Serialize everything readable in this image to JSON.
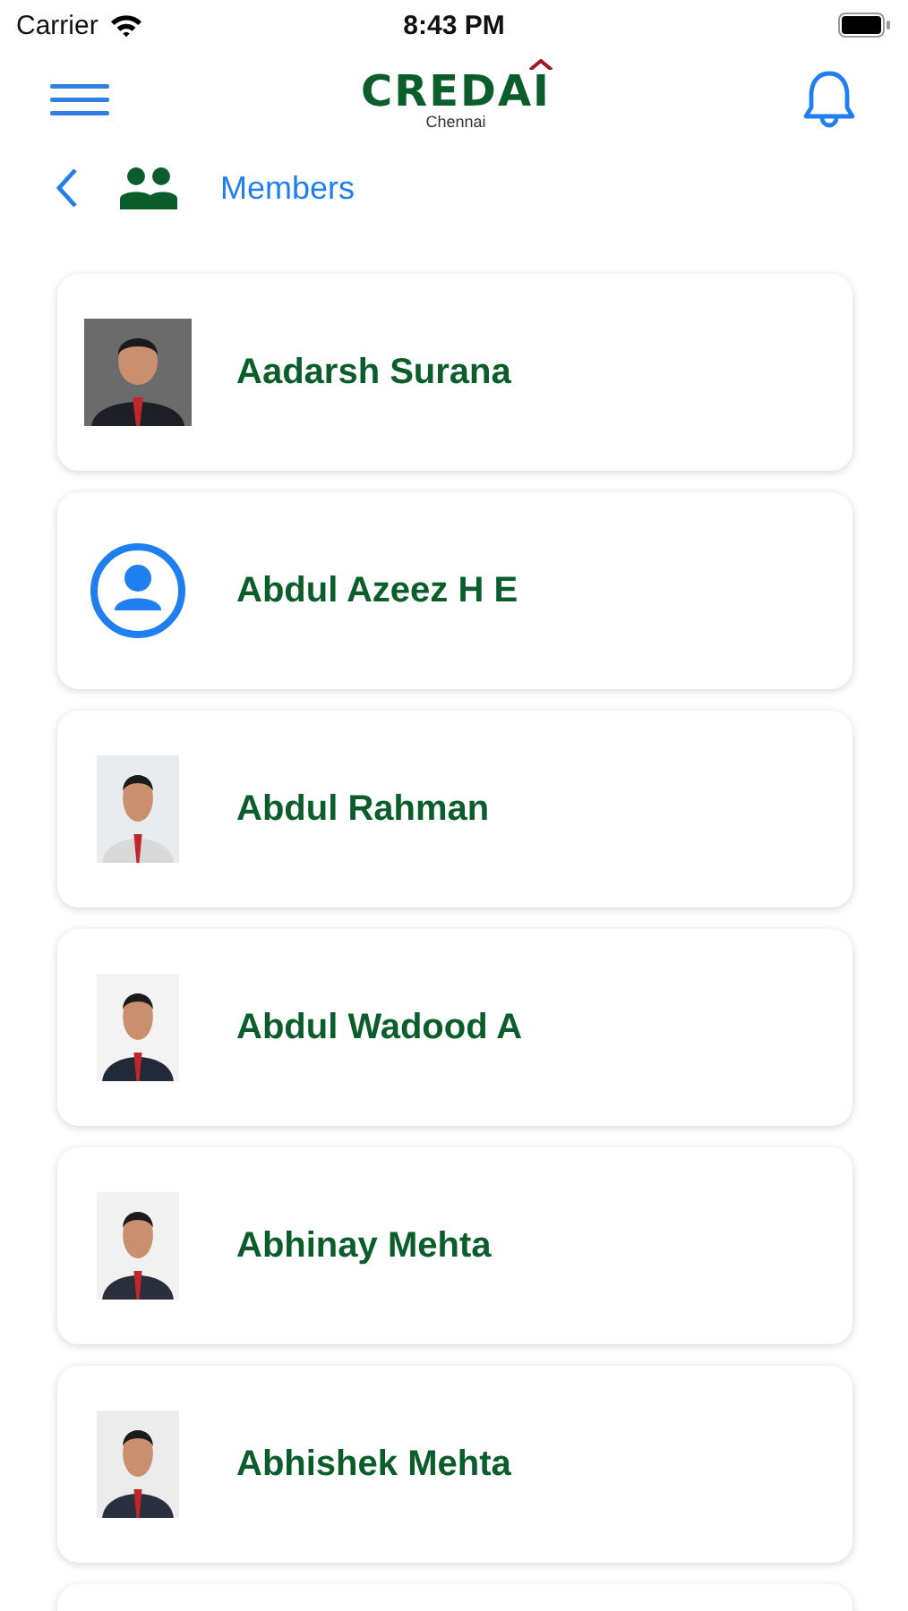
{
  "status_bar": {
    "carrier": "Carrier",
    "time": "8:43 PM"
  },
  "header": {
    "logo": "CREDAI",
    "logo_subtitle": "Chennai"
  },
  "subheader": {
    "title": "Members"
  },
  "members": [
    {
      "name": "Aadarsh Surana"
    },
    {
      "name": "Abdul Azeez H E",
      "kind": "placeholder"
    },
    {
      "name": "Abdul Rahman"
    },
    {
      "name": "Abdul Wadood A"
    },
    {
      "name": "Abhinay Mehta"
    },
    {
      "name": "Abhishek Mehta"
    }
  ]
}
